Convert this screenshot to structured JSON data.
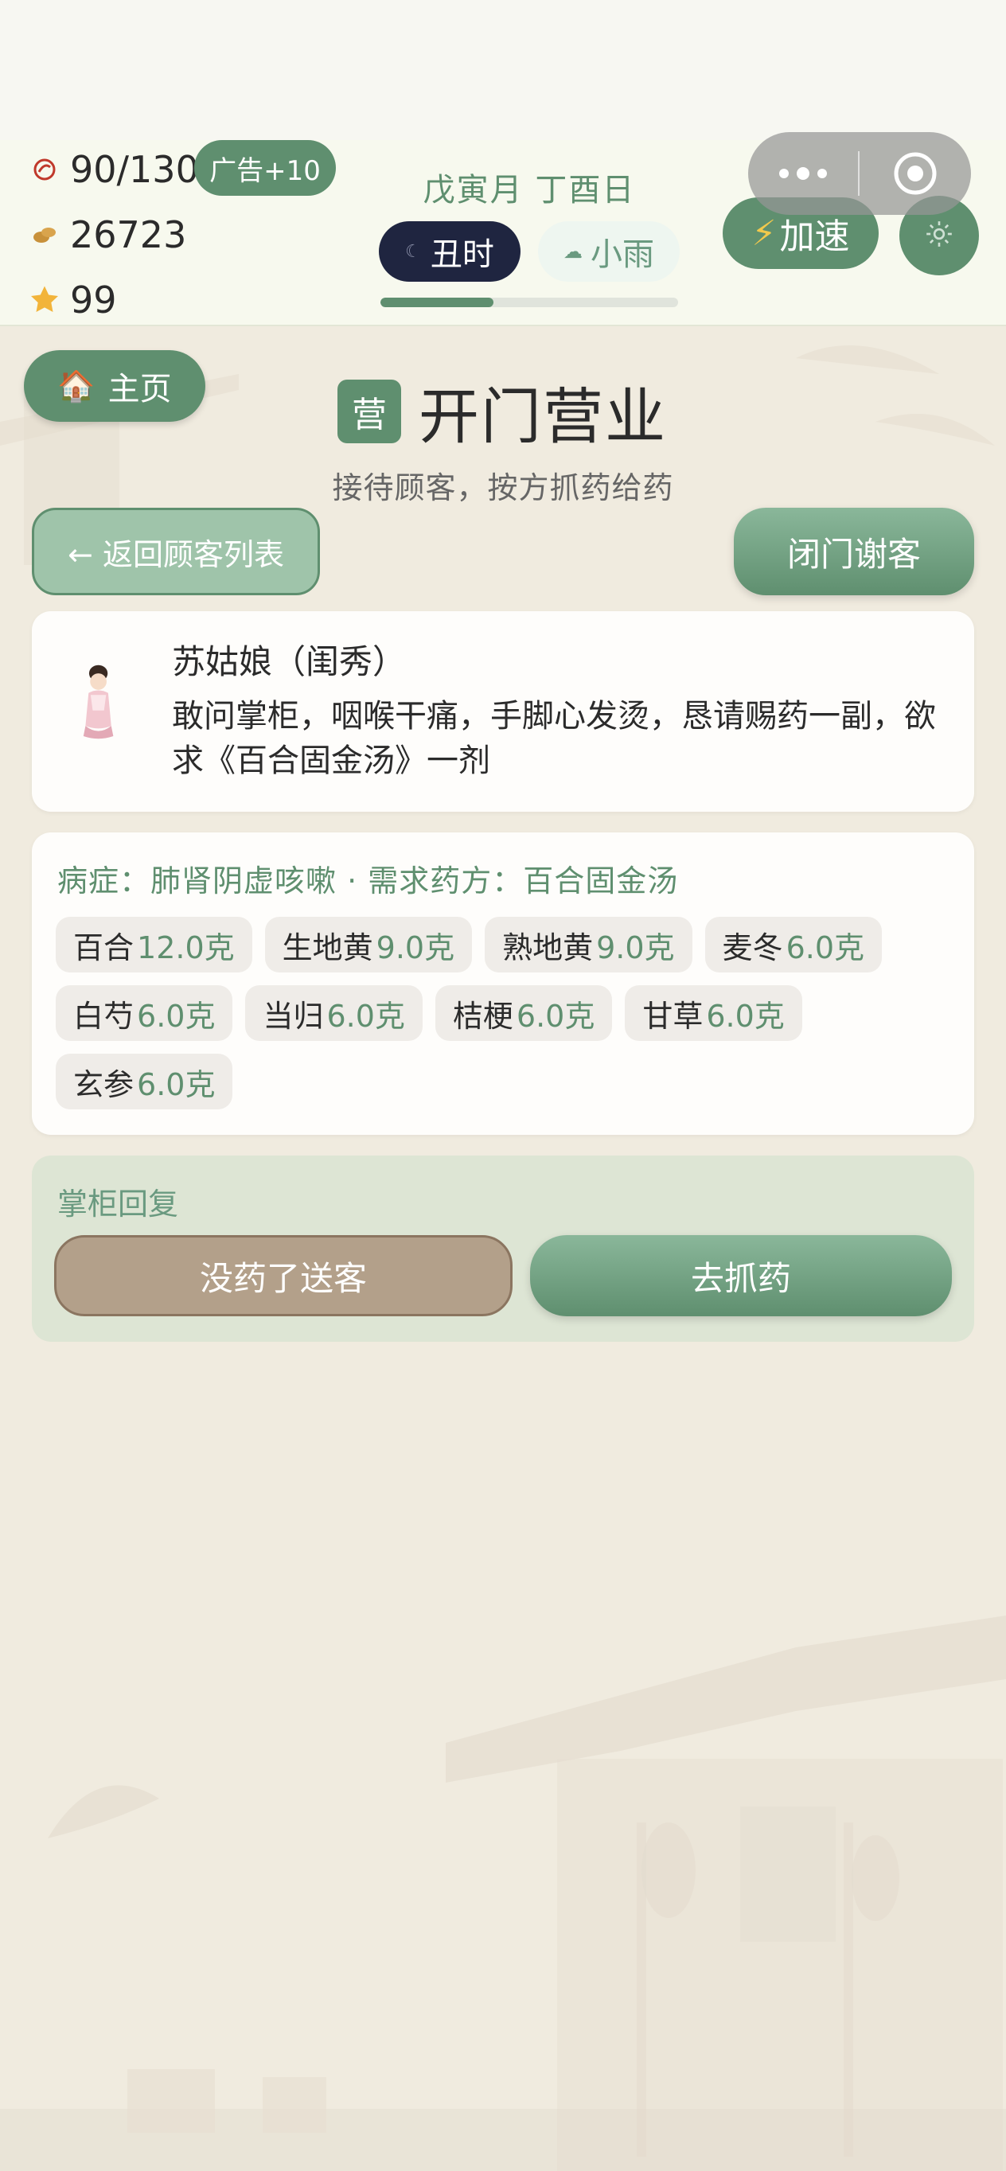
{
  "header": {
    "energy": "90/130",
    "ad_label": "广告+10",
    "coins": "26723",
    "stars": "99",
    "date": "戊寅月 丁酉日",
    "time_period": "丑时",
    "weather": "小雨",
    "day_progress": 0.38,
    "speed_label": "加速",
    "icons": [
      "energy-icon",
      "coin-icon",
      "star-icon",
      "moon-icon",
      "cloud-icon",
      "bolt-icon",
      "gear-icon",
      "more-icon",
      "target-icon",
      "house-icon"
    ]
  },
  "nav": {
    "home_label": "主页"
  },
  "page": {
    "badge": "营",
    "title": "开门营业",
    "subtitle": "接待顾客，按方抓药给药"
  },
  "actions": {
    "back_label": "← 返回顾客列表",
    "close_shop_label": "闭门谢客"
  },
  "customer": {
    "name": "苏姑娘（闺秀）",
    "message": "敢问掌柜，咽喉干痛，手脚心发烫，恳请赐药一副，欲求《百合固金汤》一剂"
  },
  "recipe": {
    "header": "病症：肺肾阴虚咳嗽 · 需求药方：百合固金汤",
    "herbs": [
      {
        "name": "百合",
        "qty": "12.0克"
      },
      {
        "name": "生地黄",
        "qty": "9.0克"
      },
      {
        "name": "熟地黄",
        "qty": "9.0克"
      },
      {
        "name": "麦冬",
        "qty": "6.0克"
      },
      {
        "name": "白芍",
        "qty": "6.0克"
      },
      {
        "name": "当归",
        "qty": "6.0克"
      },
      {
        "name": "桔梗",
        "qty": "6.0克"
      },
      {
        "name": "甘草",
        "qty": "6.0克"
      },
      {
        "name": "玄参",
        "qty": "6.0克"
      }
    ]
  },
  "reply": {
    "label": "掌柜回复",
    "send_off_label": "没药了送客",
    "grab_label": "去抓药"
  },
  "colors": {
    "accent": "#5f8f6f",
    "night_pill": "#1f2540",
    "brown_button": "#b3a08a",
    "background": "#f0ebdf"
  }
}
